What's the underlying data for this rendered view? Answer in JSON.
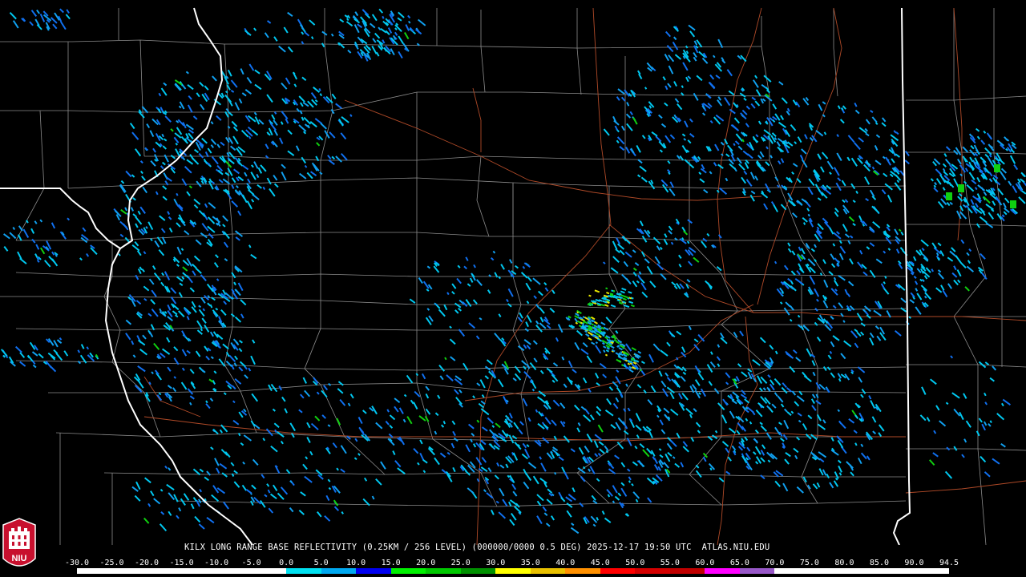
{
  "caption": {
    "text": "KILX LONG RANGE BASE REFLECTIVITY (0.25KM / 256 LEVEL) (000000/0000 0.5 DEG) 2025-12-17 19:50 UTC  ATLAS.NIU.EDU"
  },
  "logo": {
    "text": "NIU",
    "colors": {
      "shield": "#c8102e",
      "text": "#ffffff"
    }
  },
  "legend": {
    "ticks": [
      "-30.0",
      "-25.0",
      "-20.0",
      "-15.0",
      "-10.0",
      "-5.0",
      "0.0",
      "5.0",
      "10.0",
      "15.0",
      "20.0",
      "25.0",
      "30.0",
      "35.0",
      "40.0",
      "45.0",
      "50.0",
      "55.0",
      "60.0",
      "65.0",
      "70.0",
      "75.0",
      "80.0",
      "85.0",
      "90.0",
      "94.5"
    ],
    "colors": [
      "#ffffff",
      "#ffffff",
      "#ffffff",
      "#ffffff",
      "#ffffff",
      "#ffffff",
      "#00e0f0",
      "#00a8f0",
      "#0000f0",
      "#00f000",
      "#00c800",
      "#009000",
      "#ffff00",
      "#e8c000",
      "#ff9000",
      "#ff0000",
      "#d40000",
      "#c00000",
      "#ff00ff",
      "#9858c8",
      "#ffffff",
      "#ffffff",
      "#ffffff",
      "#ffffff",
      "#ffffff"
    ]
  },
  "map": {
    "colors": {
      "background": "#000000",
      "county_lines": "#8c8c8c",
      "state_lines": "#ffffff",
      "roads": "#b04a28",
      "echo_light": "#00c8f0",
      "echo_mid": "#1070f0",
      "echo_green": "#10d010",
      "echo_yellow": "#e8e800"
    }
  }
}
